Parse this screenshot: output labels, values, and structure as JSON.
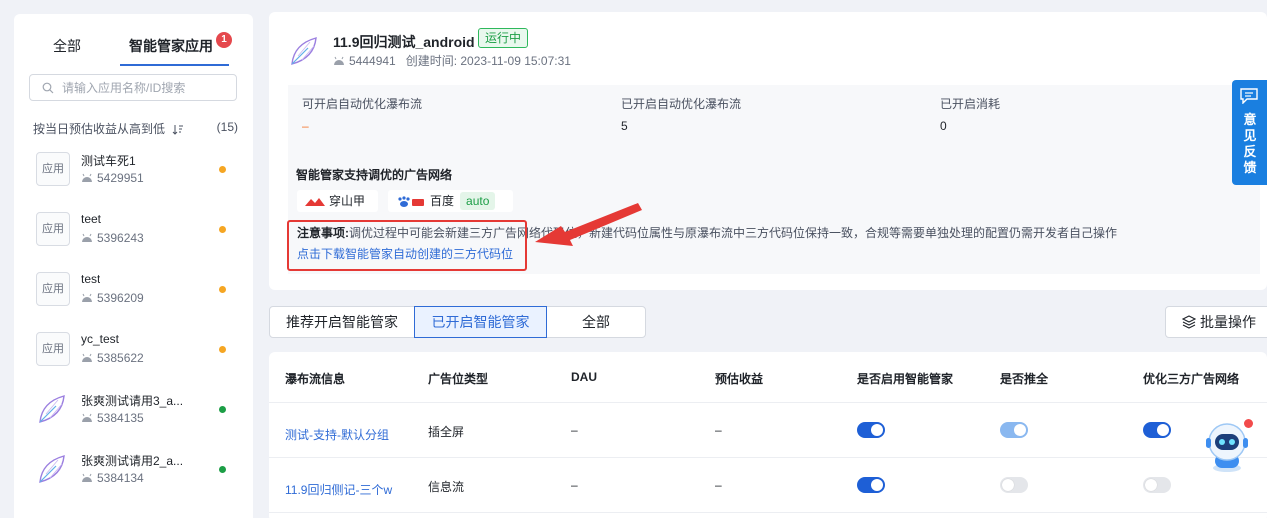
{
  "sidebar": {
    "tabs": [
      {
        "label": "全部"
      },
      {
        "label": "智能管家应用",
        "badge": "1"
      }
    ],
    "search_placeholder": "请输入应用名称/ID搜索",
    "sort_label": "按当日预估收益从高到低",
    "count": "(15)",
    "apps": [
      {
        "icon": "应用",
        "name": "测试车死1",
        "id": "5429951",
        "dot_color": "#f5a623"
      },
      {
        "icon": "应用",
        "name": "teet",
        "id": "5396243",
        "dot_color": "#f5a623"
      },
      {
        "icon": "应用",
        "name": "test",
        "id": "5396209",
        "dot_color": "#f5a623"
      },
      {
        "icon": "应用",
        "name": "yc_test",
        "id": "5385622",
        "dot_color": "#f5a623"
      },
      {
        "icon": "leaf-logo",
        "name": "张爽测试请用3_a...",
        "id": "5384135",
        "dot_color": "#1c9e46"
      },
      {
        "icon": "leaf-logo",
        "name": "张爽测试请用2_a...",
        "id": "5384134",
        "dot_color": "#1c9e46"
      }
    ]
  },
  "header": {
    "title": "11.9回归测试_android",
    "status": "运行中",
    "app_id": "5444941",
    "created": "创建时间: 2023-11-09 15:07:31"
  },
  "stats": [
    {
      "label": "可开启自动优化瀑布流",
      "value": "–"
    },
    {
      "label": "已开启自动优化瀑布流",
      "value": "5"
    },
    {
      "label": "已开启消耗",
      "value": "0"
    }
  ],
  "network": {
    "title": "智能管家支持调优的广告网络",
    "chips": [
      {
        "name": "穿山甲",
        "icon": "pangle-logo"
      },
      {
        "name": "百度",
        "icon": "baidu-logo",
        "tag": "auto"
      }
    ],
    "notice_label": "注意事项:",
    "notice_text": "调优过程中可能会新建三方广告网络代码位，新建代码位属性与原瀑布流中三方代码位保持一致，合规等需要单独处理的配置仍需开发者自己操作",
    "download_link": "点击下载智能管家自动创建的三方代码位"
  },
  "filter_tabs": [
    {
      "label": "推荐开启智能管家",
      "active": false
    },
    {
      "label": "已开启智能管家",
      "active": true
    },
    {
      "label": "全部",
      "active": false
    }
  ],
  "batch_button": "批量操作",
  "table": {
    "headers": [
      "瀑布流信息",
      "广告位类型",
      "DAU",
      "预估收益",
      "是否启用智能管家",
      "是否推全",
      "优化三方广告网络"
    ],
    "rows": [
      {
        "name": "测试-支持-默认分组",
        "type": "插全屏",
        "dau": "–",
        "revenue": "–",
        "enabled": "on",
        "full": "on-light",
        "optimize": "on"
      },
      {
        "name": "11.9回归侧记-三个w",
        "type": "信息流",
        "dau": "–",
        "revenue": "–",
        "enabled": "on",
        "full": "off",
        "optimize": "off"
      }
    ]
  },
  "feedback": {
    "label": "意见反馈"
  },
  "colors": {
    "accent": "#2f6bd6",
    "feedback": "#1a7fe0",
    "annotation": "#e53935"
  }
}
